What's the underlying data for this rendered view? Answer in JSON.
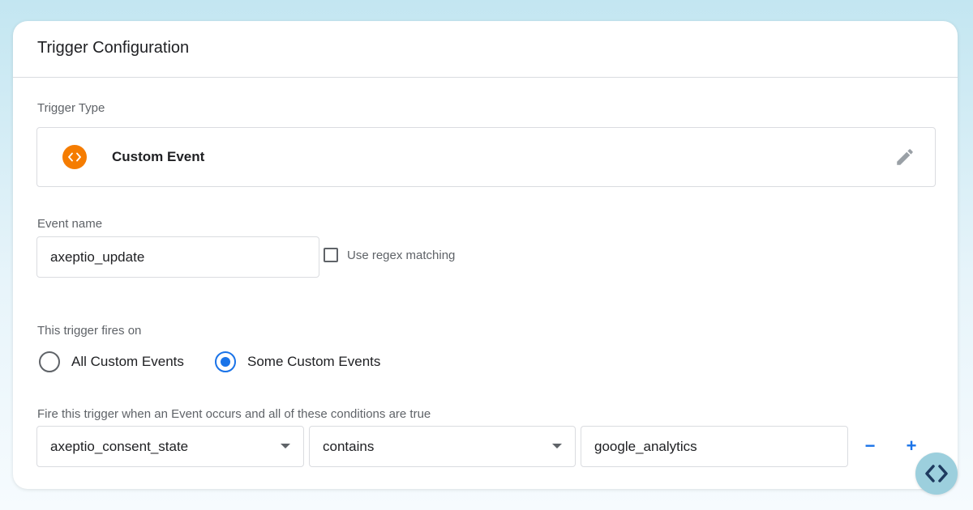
{
  "card": {
    "title": "Trigger Configuration"
  },
  "trigger_type": {
    "label": "Trigger Type",
    "name": "Custom Event",
    "icon": "code-brackets-icon",
    "icon_color": "#f57c00"
  },
  "event_name": {
    "label": "Event name",
    "value": "axeptio_update",
    "regex_label": "Use regex matching",
    "regex_checked": false
  },
  "fires_on": {
    "label": "This trigger fires on",
    "options": [
      {
        "label": "All Custom Events",
        "selected": false
      },
      {
        "label": "Some Custom Events",
        "selected": true
      }
    ]
  },
  "conditions": {
    "label": "Fire this trigger when an Event occurs and all of these conditions are true",
    "rows": [
      {
        "variable": "axeptio_consent_state",
        "operator": "contains",
        "value": "google_analytics"
      }
    ],
    "remove_label": "−",
    "add_label": "+"
  },
  "colors": {
    "accent": "#1a73e8",
    "badge": "#9ccfdd",
    "badge_icon": "#1e3a5f"
  }
}
